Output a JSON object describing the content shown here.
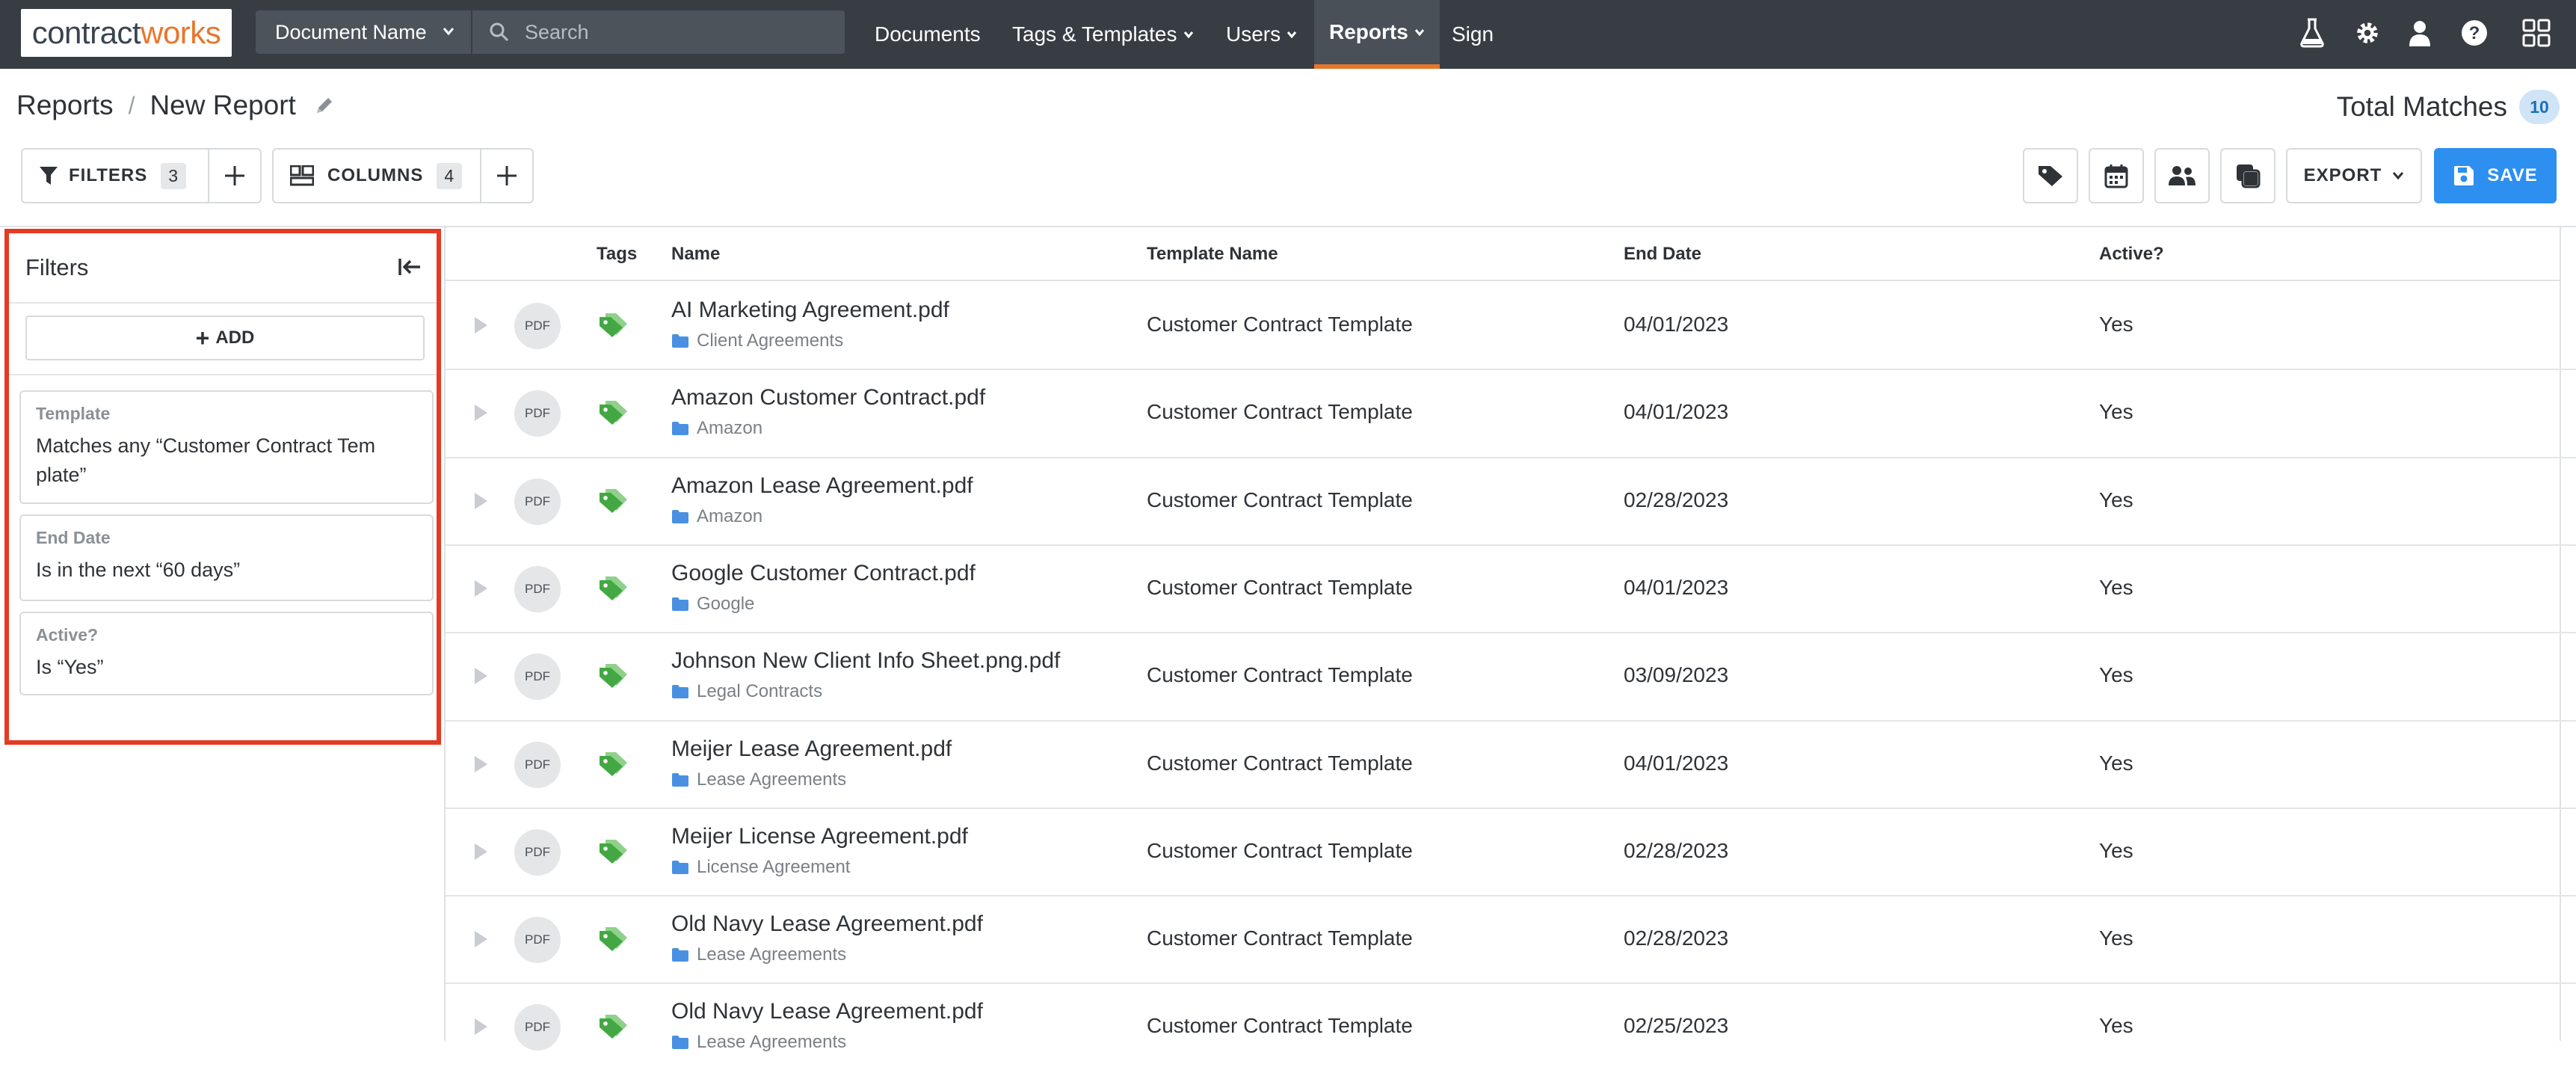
{
  "app": {
    "logo_part1": "contract",
    "logo_part2": "works",
    "brand_accent": "#e8762b",
    "primary_blue": "#2d8ff0",
    "highlight_red": "#e53a23"
  },
  "topnav": {
    "search_scope": "Document Name",
    "search_placeholder": "Search",
    "links": {
      "documents": "Documents",
      "tags_templates": "Tags & Templates",
      "users": "Users",
      "reports": "Reports",
      "sign": "Sign"
    },
    "icons": [
      "flask-icon",
      "gear-icon",
      "user-icon",
      "help-icon",
      "apps-grid-icon"
    ]
  },
  "header": {
    "breadcrumb_root": "Reports",
    "breadcrumb_sep": "/",
    "report_name": "New Report",
    "total_label": "Total Matches",
    "total_count": "10"
  },
  "toolbar": {
    "filters_label": "FILTERS",
    "filters_count": "3",
    "columns_label": "COLUMNS",
    "columns_count": "4",
    "export_label": "EXPORT",
    "save_label": "SAVE"
  },
  "filters_panel": {
    "title": "Filters",
    "add_label": "ADD",
    "filters": [
      {
        "label": "Template",
        "value": "Matches any “Customer Contract Tem plate”"
      },
      {
        "label": "End Date",
        "value": "Is in the next “60 days”"
      },
      {
        "label": "Active?",
        "value": "Is “Yes”"
      }
    ]
  },
  "table": {
    "headers": {
      "tags": "Tags",
      "name": "Name",
      "template": "Template Name",
      "end_date": "End Date",
      "active": "Active?"
    },
    "file_badge": "PDF",
    "rows": [
      {
        "name": "AI Marketing Agreement.pdf",
        "folder": "Client Agreements",
        "template": "Customer Contract Template",
        "end_date": "04/01/2023",
        "active": "Yes"
      },
      {
        "name": "Amazon Customer Contract.pdf",
        "folder": "Amazon",
        "template": "Customer Contract Template",
        "end_date": "04/01/2023",
        "active": "Yes"
      },
      {
        "name": "Amazon Lease Agreement.pdf",
        "folder": "Amazon",
        "template": "Customer Contract Template",
        "end_date": "02/28/2023",
        "active": "Yes"
      },
      {
        "name": "Google Customer Contract.pdf",
        "folder": "Google",
        "template": "Customer Contract Template",
        "end_date": "04/01/2023",
        "active": "Yes"
      },
      {
        "name": "Johnson New Client Info Sheet.png.pdf",
        "folder": "Legal Contracts",
        "template": "Customer Contract Template",
        "end_date": "03/09/2023",
        "active": "Yes"
      },
      {
        "name": "Meijer Lease Agreement.pdf",
        "folder": "Lease Agreements",
        "template": "Customer Contract Template",
        "end_date": "04/01/2023",
        "active": "Yes"
      },
      {
        "name": "Meijer License Agreement.pdf",
        "folder": "License Agreement",
        "template": "Customer Contract Template",
        "end_date": "02/28/2023",
        "active": "Yes"
      },
      {
        "name": "Old Navy Lease Agreement.pdf",
        "folder": "Lease Agreements",
        "template": "Customer Contract Template",
        "end_date": "02/28/2023",
        "active": "Yes"
      },
      {
        "name": "Old Navy Lease Agreement.pdf",
        "folder": "Lease Agreements",
        "template": "Customer Contract Template",
        "end_date": "02/25/2023",
        "active": "Yes"
      }
    ]
  }
}
